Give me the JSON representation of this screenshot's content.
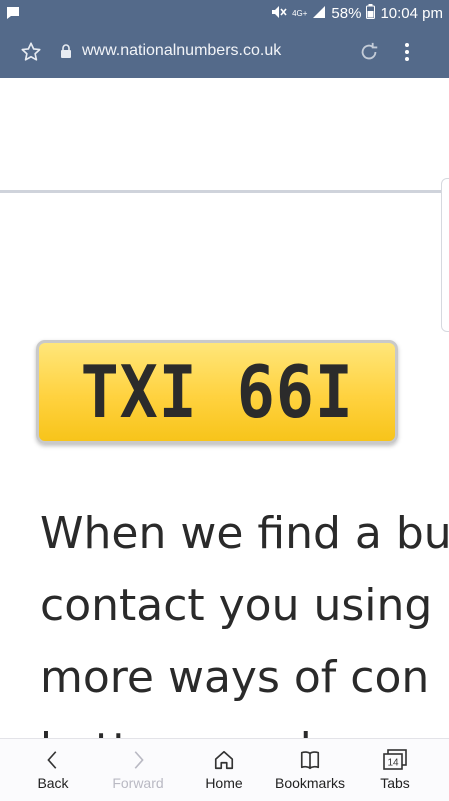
{
  "status_bar": {
    "network_label": "4G+",
    "battery_percent": "58%",
    "time": "10:04 pm",
    "icons": [
      "chat-icon",
      "mute-icon",
      "signal-icon",
      "battery-icon"
    ]
  },
  "browser": {
    "url": "www.nationalnumbers.co.uk",
    "icons": [
      "star-icon",
      "lock-icon",
      "reload-icon",
      "overflow-menu-icon"
    ]
  },
  "page": {
    "plate_text": "TXI 66I",
    "body_lines": [
      "When we find a bu",
      "contact you using",
      "more ways of con",
      "better our chance"
    ]
  },
  "bottom_nav": {
    "items": [
      {
        "label": "Back",
        "icon": "chevron-left-icon",
        "enabled": true
      },
      {
        "label": "Forward",
        "icon": "chevron-right-icon",
        "enabled": false
      },
      {
        "label": "Home",
        "icon": "home-icon",
        "enabled": true
      },
      {
        "label": "Bookmarks",
        "icon": "bookmarks-icon",
        "enabled": true
      },
      {
        "label": "Tabs",
        "icon": "tabs-icon",
        "enabled": true,
        "count": "14"
      }
    ]
  },
  "colors": {
    "toolbar": "#546a8a",
    "plate_yellow": "#ffd23f",
    "text": "#2a2a2a"
  }
}
